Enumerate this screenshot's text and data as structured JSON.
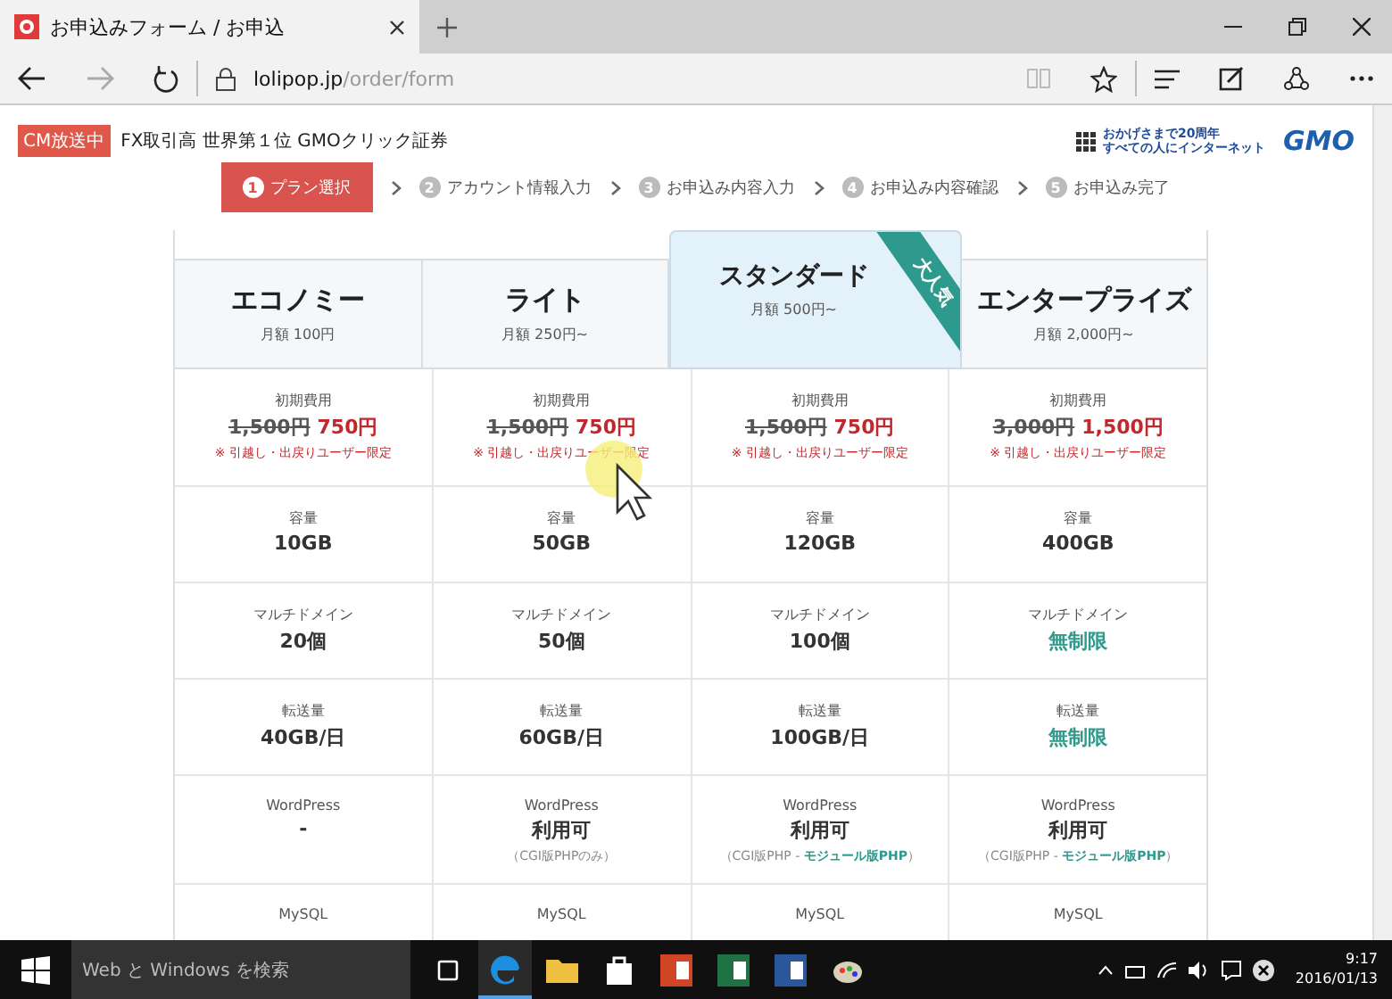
{
  "browser": {
    "tab_title": "お申込みフォーム / お申込",
    "url_host": "lolipop.jp",
    "url_path": "/order/form"
  },
  "ad": {
    "tag": "CM放送中",
    "text": "FX取引高 世界第１位 GMOクリック証券",
    "slogan_1": "おかげさまで20周年",
    "slogan_2": "すべての人にインターネット",
    "logo": "GMO"
  },
  "steps": [
    {
      "num": "1",
      "label": "プラン選択",
      "selected": true
    },
    {
      "num": "2",
      "label": "アカウント情報入力",
      "selected": false
    },
    {
      "num": "3",
      "label": "お申込み内容入力",
      "selected": false
    },
    {
      "num": "4",
      "label": "お申込み内容確認",
      "selected": false
    },
    {
      "num": "5",
      "label": "お申込み完了",
      "selected": false
    }
  ],
  "plans": [
    {
      "name": "エコノミー",
      "price": "月額 100円",
      "featured": false
    },
    {
      "name": "ライト",
      "price": "月額 250円~",
      "featured": false
    },
    {
      "name": "スタンダード",
      "price": "月額 500円~",
      "featured": true,
      "badge": "大人気"
    },
    {
      "name": "エンタープライズ",
      "price": "月額 2,000円~",
      "featured": false
    }
  ],
  "rows": [
    {
      "kind": "cost",
      "cells": [
        {
          "label": "初期費用",
          "old": "1,500円",
          "new": "750円",
          "note": "※ 引越し・出戻りユーザー限定"
        },
        {
          "label": "初期費用",
          "old": "1,500円",
          "new": "750円",
          "note": "※ 引越し・出戻りユーザー限定"
        },
        {
          "label": "初期費用",
          "old": "1,500円",
          "new": "750円",
          "note": "※ 引越し・出戻りユーザー限定"
        },
        {
          "label": "初期費用",
          "old": "3,000円",
          "new": "1,500円",
          "note": "※ 引越し・出戻りユーザー限定"
        }
      ]
    },
    {
      "kind": "value",
      "cells": [
        {
          "label": "容量",
          "value": "10GB",
          "accent": false
        },
        {
          "label": "容量",
          "value": "50GB",
          "accent": false
        },
        {
          "label": "容量",
          "value": "120GB",
          "accent": false
        },
        {
          "label": "容量",
          "value": "400GB",
          "accent": false
        }
      ]
    },
    {
      "kind": "value",
      "cells": [
        {
          "label": "マルチドメイン",
          "value": "20個",
          "accent": false
        },
        {
          "label": "マルチドメイン",
          "value": "50個",
          "accent": false
        },
        {
          "label": "マルチドメイン",
          "value": "100個",
          "accent": false
        },
        {
          "label": "マルチドメイン",
          "value": "無制限",
          "accent": true
        }
      ]
    },
    {
      "kind": "value",
      "cells": [
        {
          "label": "転送量",
          "value": "40GB/日",
          "accent": false
        },
        {
          "label": "転送量",
          "value": "60GB/日",
          "accent": false
        },
        {
          "label": "転送量",
          "value": "100GB/日",
          "accent": false
        },
        {
          "label": "転送量",
          "value": "無制限",
          "accent": true
        }
      ]
    },
    {
      "kind": "value",
      "cells": [
        {
          "label": "WordPress",
          "value": "-",
          "accent": false
        },
        {
          "label": "WordPress",
          "value": "利用可",
          "accent": false,
          "sub": [
            {
              "text": "（CGI版PHPのみ）",
              "accent": false
            }
          ]
        },
        {
          "label": "WordPress",
          "value": "利用可",
          "accent": false,
          "sub": [
            {
              "text": "（CGI版PHP - ",
              "accent": false
            },
            {
              "text": "モジュール版PHP",
              "accent": true
            },
            {
              "text": "）",
              "accent": false
            }
          ]
        },
        {
          "label": "WordPress",
          "value": "利用可",
          "accent": false,
          "sub": [
            {
              "text": "（CGI版PHP - ",
              "accent": false
            },
            {
              "text": "モジュール版PHP",
              "accent": true
            },
            {
              "text": "）",
              "accent": false
            }
          ]
        }
      ]
    },
    {
      "kind": "value",
      "cells": [
        {
          "label": "MySQL"
        },
        {
          "label": "MySQL"
        },
        {
          "label": "MySQL"
        },
        {
          "label": "MySQL"
        }
      ]
    }
  ],
  "taskbar": {
    "search_placeholder": "Web と Windows を検索",
    "time": "9:17",
    "date": "2016/01/13"
  }
}
